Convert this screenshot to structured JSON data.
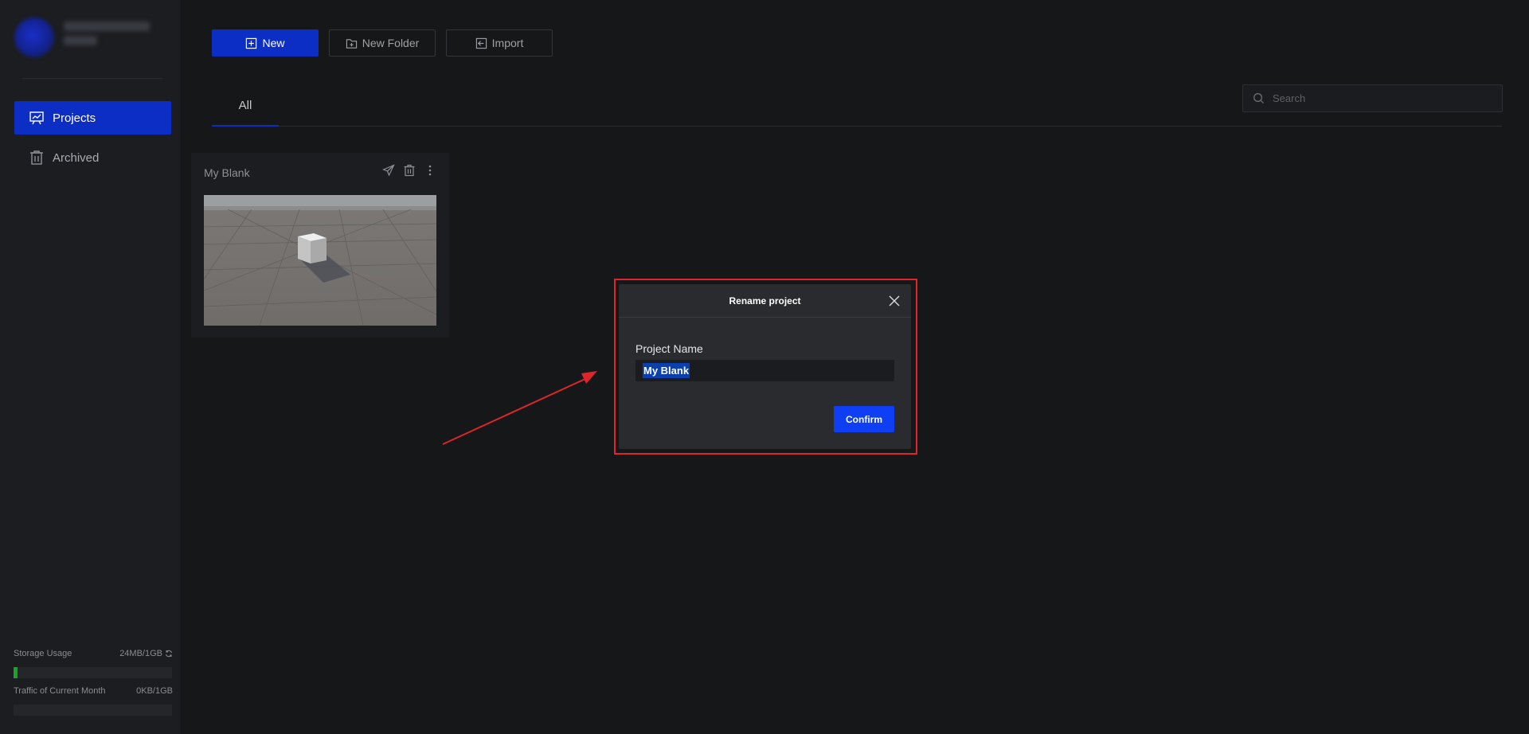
{
  "sidebar": {
    "items": [
      {
        "label": "Projects",
        "icon": "presentation-chart-icon",
        "active": true
      },
      {
        "label": "Archived",
        "icon": "trash-icon",
        "active": false
      }
    ],
    "storage": {
      "label": "Storage Usage",
      "value": "24MB/1GB",
      "fraction": 0.023
    },
    "traffic": {
      "label": "Traffic of Current Month",
      "value": "0KB/1GB",
      "fraction": 0
    }
  },
  "toolbar": {
    "new_label": "New",
    "new_folder_label": "New Folder",
    "import_label": "Import"
  },
  "tabs": [
    {
      "label": "All",
      "active": true
    }
  ],
  "search": {
    "placeholder": "Search",
    "value": ""
  },
  "projects": [
    {
      "title": "My Blank",
      "actions": [
        "send-icon",
        "trash-icon",
        "more-vertical-icon"
      ]
    }
  ],
  "modal": {
    "title": "Rename project",
    "field_label": "Project Name",
    "field_value": "My Blank",
    "confirm_label": "Confirm"
  },
  "colors": {
    "accent": "#0d2ec5",
    "confirm": "#0f3ff5",
    "highlight_frame": "#e0242b",
    "storage_fill": "#18a526",
    "background": "#161719"
  }
}
